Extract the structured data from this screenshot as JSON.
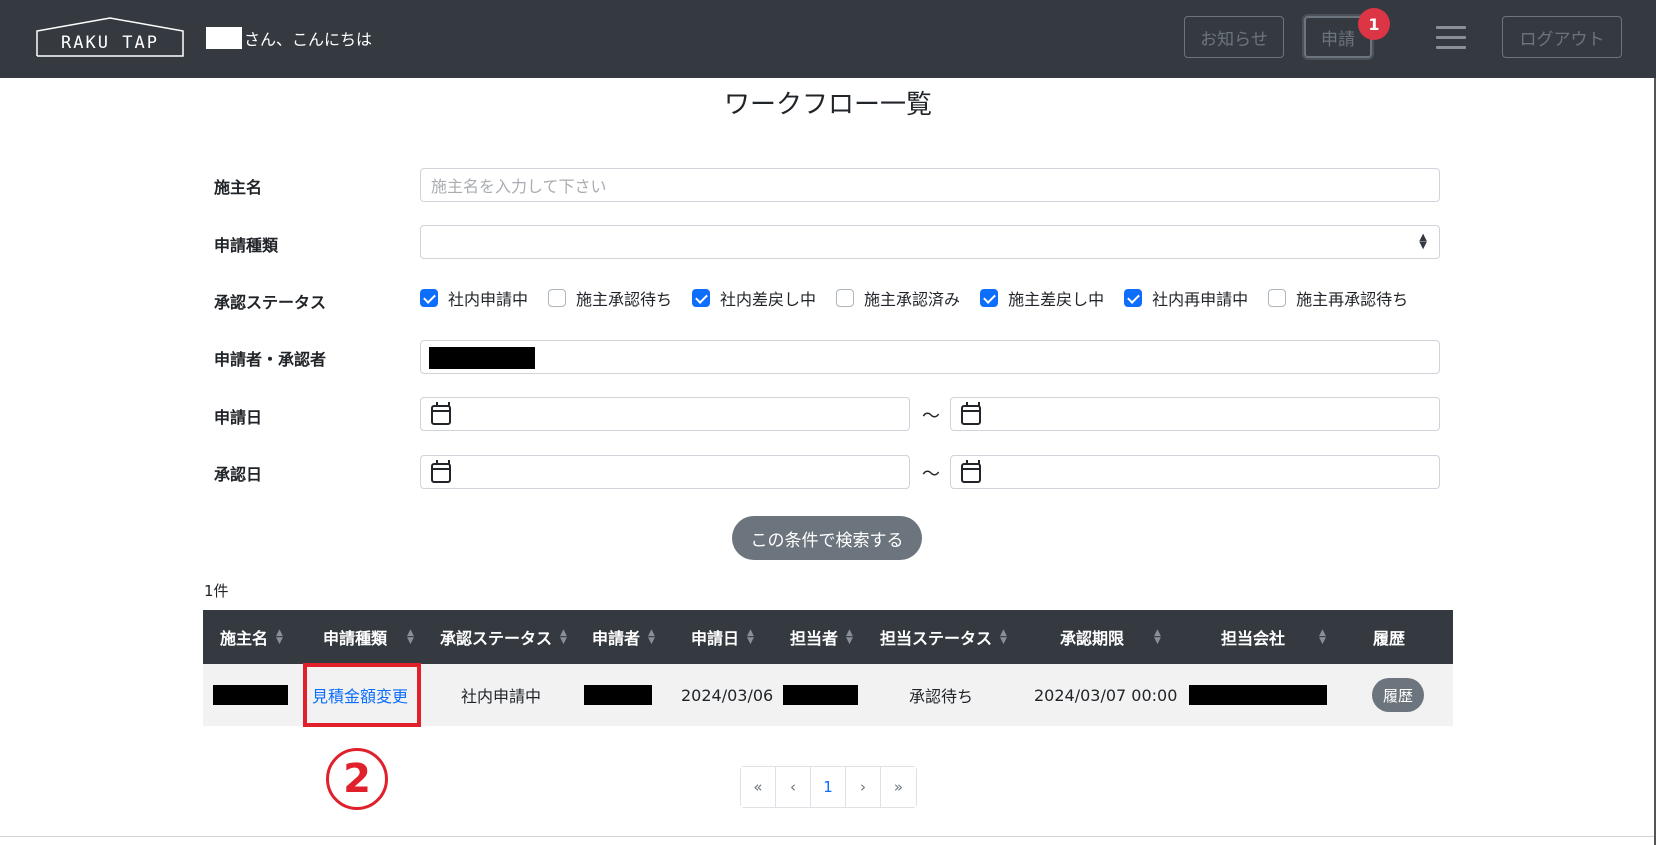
{
  "navbar": {
    "logo_text": "RAKU TAP",
    "greeting": "さん、こんにちは",
    "notice_label": "お知らせ",
    "apply_label": "申請",
    "apply_badge": "1",
    "logout_label": "ログアウト"
  },
  "page": {
    "title": "ワークフロー一覧"
  },
  "form": {
    "owner_label": "施主名",
    "owner_placeholder": "施主名を入力して下さい",
    "type_label": "申請種類",
    "status_label": "承認ステータス",
    "statuses": [
      {
        "label": "社内申請中",
        "checked": true
      },
      {
        "label": "施主承認待ち",
        "checked": false
      },
      {
        "label": "社内差戻し中",
        "checked": true
      },
      {
        "label": "施主承認済み",
        "checked": false
      },
      {
        "label": "施主差戻し中",
        "checked": true
      },
      {
        "label": "社内再申請中",
        "checked": true
      },
      {
        "label": "施主再承認待ち",
        "checked": false
      }
    ],
    "applicant_label": "申請者・承認者",
    "apply_date_label": "申請日",
    "approve_date_label": "承認日",
    "range_sep": "～",
    "search_button": "この条件で検索する"
  },
  "result_count": "1件",
  "table": {
    "headers": [
      "施主名",
      "申請種類",
      "承認ステータス",
      "申請者",
      "申請日",
      "担当者",
      "担当ステータス",
      "承認期限",
      "担当会社",
      "履歴"
    ],
    "row": {
      "type": "見積金額変更",
      "status": "社内申請中",
      "apply_date": "2024/03/06",
      "staff_status": "承認待ち",
      "deadline": "2024/03/07 00:00",
      "history_button": "履歴"
    }
  },
  "annotation": {
    "step": "2"
  },
  "pagination": {
    "first": "«",
    "prev": "‹",
    "current": "1",
    "next": "›",
    "last": "»"
  }
}
